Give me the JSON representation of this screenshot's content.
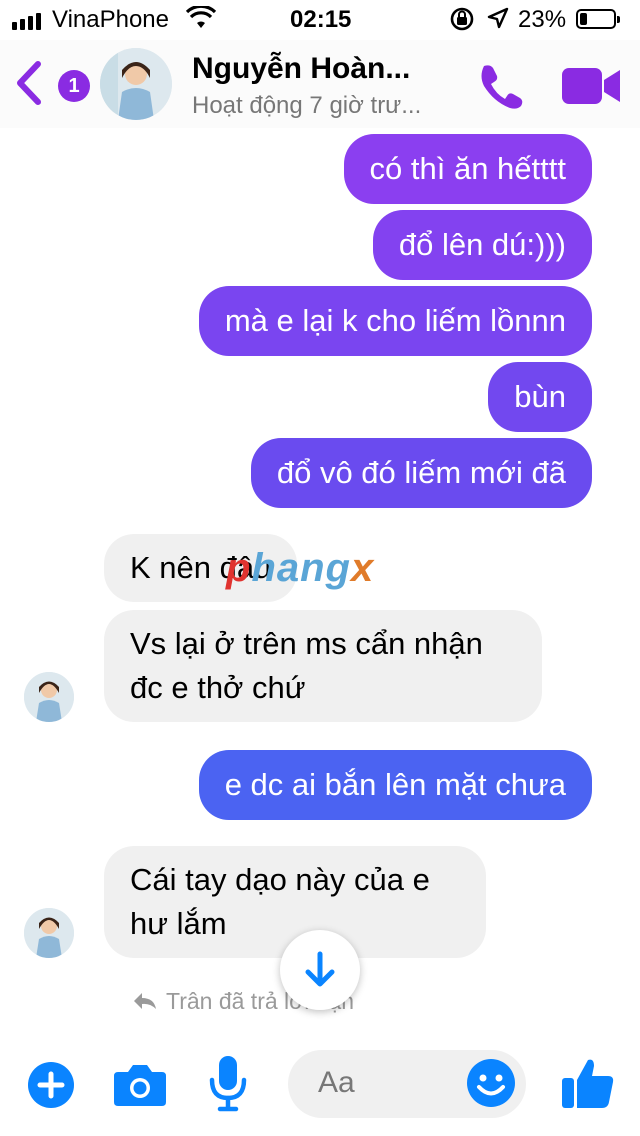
{
  "status_bar": {
    "carrier": "VinaPhone",
    "time": "02:15",
    "battery_percent": "23%",
    "battery_level": 0.23
  },
  "header": {
    "unread_count": "1",
    "contact_name": "Nguyễn Hoàn...",
    "contact_status": "Hoạt động 7 giờ trư..."
  },
  "messages": [
    {
      "direction": "outgoing",
      "text": "có thì ăn hếtttt"
    },
    {
      "direction": "outgoing",
      "text": "đổ lên dú:)))"
    },
    {
      "direction": "outgoing",
      "text": "mà e lại k cho liếm lồnnn"
    },
    {
      "direction": "outgoing",
      "text": "bùn"
    },
    {
      "direction": "outgoing",
      "text": "đổ vô đó liếm mới đã"
    },
    {
      "direction": "incoming",
      "text": "K nên đâu"
    },
    {
      "direction": "incoming",
      "lines": [
        "Vs lại ở trên ms cẩn nhận",
        "đc e thở chứ"
      ]
    },
    {
      "direction": "outgoing",
      "text": "e dc ai bắn lên mặt chưa"
    },
    {
      "direction": "incoming",
      "lines": [
        "Cái tay dạo này của e",
        "hư lắm"
      ]
    }
  ],
  "watermark": {
    "a": "p",
    "b": "hang",
    "c": "x"
  },
  "reply_note": "Trân đã trả lời bạn",
  "composer": {
    "placeholder": "Aa"
  },
  "colors": {
    "accent": "#8a2be2",
    "bubble_purple": "#8b3ff0",
    "bubble_indigo": "#6a4bef",
    "bubble_blue": "#4b63f2",
    "incoming_bg": "#f0f0f0",
    "composer_blue": "#0a84ff"
  },
  "icons": [
    "back-chevron-icon",
    "phone-icon",
    "video-camera-icon",
    "arrow-down-icon",
    "reply-arrow-icon",
    "plus-icon",
    "camera-icon",
    "microphone-icon",
    "emoji-icon",
    "thumbs-up-icon"
  ]
}
